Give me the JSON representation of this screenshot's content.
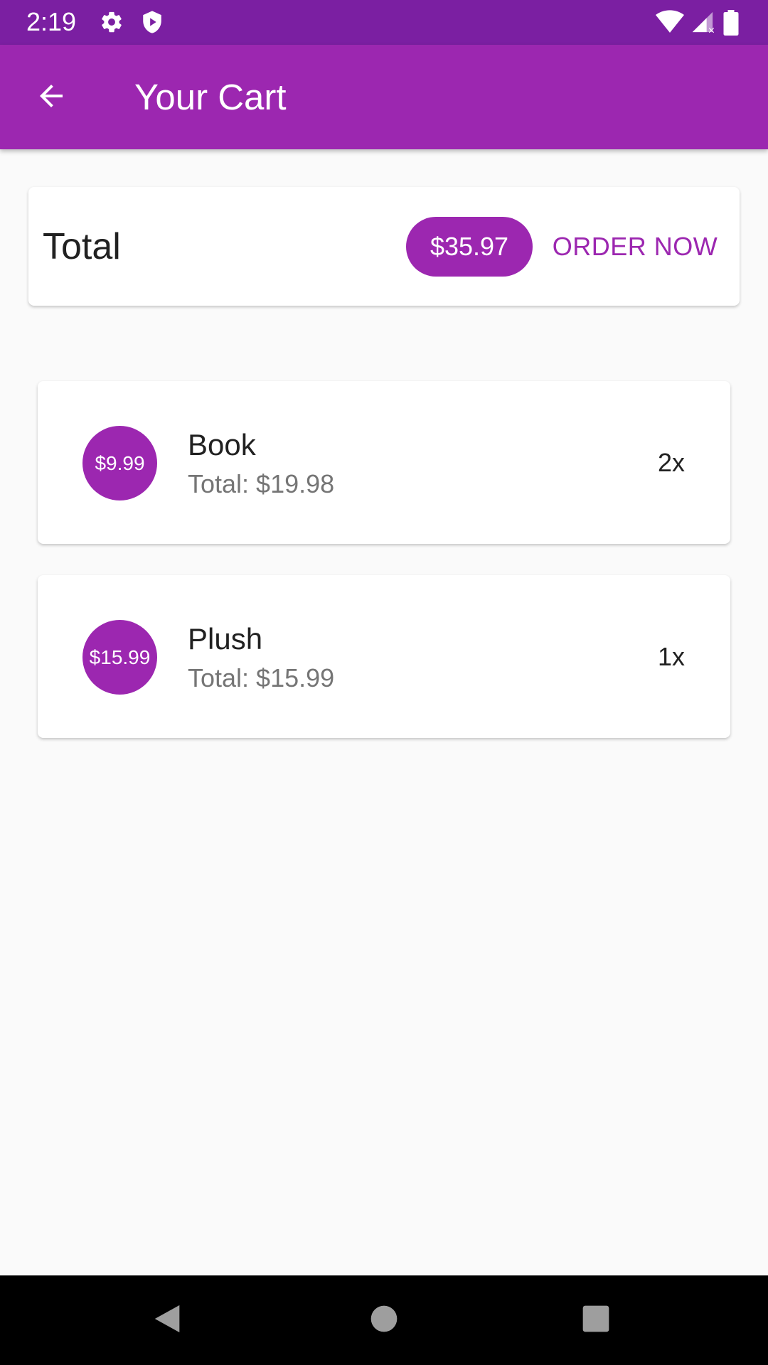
{
  "status_bar": {
    "time": "2:19",
    "icons": [
      "settings-icon",
      "shield-icon",
      "wifi-icon",
      "signal-icon",
      "battery-icon"
    ]
  },
  "app_bar": {
    "title": "Your Cart",
    "back_icon": "arrow-back-icon",
    "color": "#9c27b0"
  },
  "summary": {
    "label": "Total",
    "amount": "$35.97",
    "order_button": "ORDER NOW"
  },
  "items": [
    {
      "price": "$9.99",
      "name": "Book",
      "total": "Total: $19.98",
      "qty": "2x"
    },
    {
      "price": "$15.99",
      "name": "Plush",
      "total": "Total: $15.99",
      "qty": "1x"
    }
  ],
  "nav_bar": {
    "buttons": [
      "back-triangle-icon",
      "home-circle-icon",
      "recents-square-icon"
    ]
  },
  "colors": {
    "primary": "#9c27b0",
    "primary_dark": "#7b1fa2",
    "background": "#fafafa"
  }
}
